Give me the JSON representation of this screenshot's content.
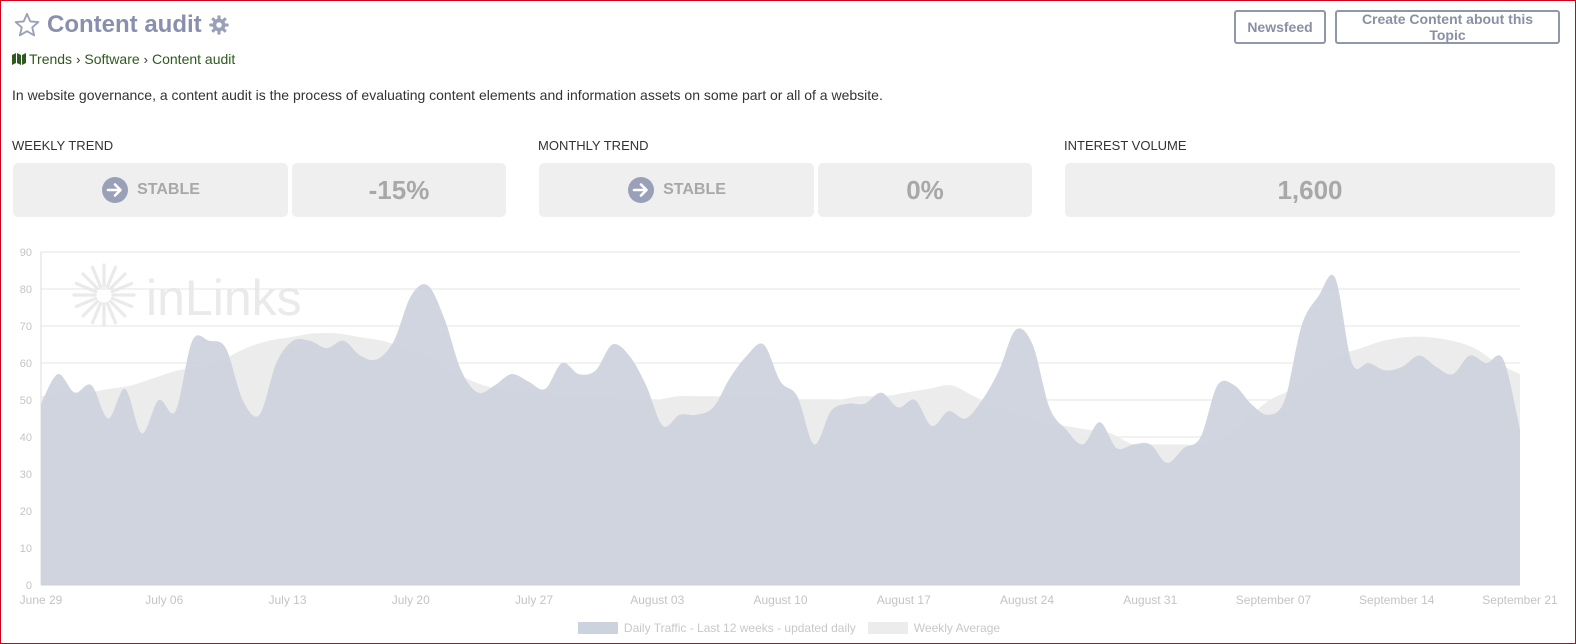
{
  "header": {
    "title": "Content audit",
    "star_icon": "star-outline-icon",
    "settings_icon": "gear-icon"
  },
  "buttons": {
    "newsfeed": "Newsfeed",
    "create": "Create Content about this Topic"
  },
  "breadcrumb": {
    "icon": "map-icon",
    "items": [
      "Trends",
      "Software",
      "Content audit"
    ]
  },
  "description": "In website governance, a content audit is the process of evaluating content elements and information assets on some part or all of a website.",
  "metrics": {
    "weekly": {
      "label": "WEEKLY TREND",
      "status": "STABLE",
      "change": "-15%"
    },
    "monthly": {
      "label": "MONTHLY TREND",
      "status": "STABLE",
      "change": "0%"
    },
    "volume": {
      "label": "INTEREST VOLUME",
      "value": "1,600"
    }
  },
  "colors": {
    "title": "#8a8fb0",
    "daily_fill": "#cdd3de",
    "weekly_fill": "#ececec",
    "tile_bg": "#efefef",
    "breadcrumb_link": "#2d5a1e"
  },
  "watermark": "inLinks",
  "chart_data": {
    "type": "area",
    "ylim": [
      0,
      90
    ],
    "yticks": [
      0,
      10,
      20,
      30,
      40,
      50,
      60,
      70,
      80,
      90
    ],
    "xtick_labels": [
      "June 29",
      "July 06",
      "July 13",
      "July 20",
      "July 27",
      "August 03",
      "August 10",
      "August 17",
      "August 24",
      "August 31",
      "September 07",
      "September 14",
      "September 21"
    ],
    "x_start": "2020-06-29",
    "x_end": "2020-09-21",
    "series": [
      {
        "name": "Daily Traffic - Last 12 weeks - updated daily",
        "values": [
          49,
          57,
          52,
          54,
          45,
          53,
          41,
          50,
          47,
          66,
          66,
          64,
          50,
          46,
          60,
          66,
          66,
          64,
          66,
          62,
          61,
          66,
          78,
          81,
          72,
          58,
          52,
          54,
          57,
          55,
          53,
          60,
          57,
          58,
          65,
          62,
          54,
          43,
          46,
          46,
          48,
          56,
          62,
          65,
          55,
          51,
          38,
          47,
          49,
          49,
          52,
          48,
          50,
          43,
          47,
          45,
          50,
          58,
          69,
          65,
          48,
          42,
          38,
          44,
          37,
          38,
          38,
          33,
          37,
          40,
          54,
          54,
          49,
          46,
          50,
          70,
          78,
          83,
          60,
          60,
          58,
          59,
          62,
          59,
          57,
          62,
          60,
          61,
          42
        ]
      },
      {
        "name": "Weekly Average",
        "values": [
          51,
          52,
          52,
          53,
          54,
          56,
          58,
          59,
          61,
          64,
          66,
          67,
          68,
          68,
          67,
          66,
          64,
          62,
          58,
          55,
          53,
          52,
          52,
          51,
          51,
          51,
          50,
          50,
          51,
          51,
          51,
          51,
          51,
          50,
          50,
          50,
          51,
          51,
          52,
          53,
          54,
          51,
          48,
          46,
          44,
          43,
          42,
          41,
          38,
          38,
          38,
          38,
          40,
          45,
          50,
          53,
          58,
          62,
          64,
          66,
          67,
          67,
          66,
          64,
          60,
          57
        ]
      }
    ]
  }
}
